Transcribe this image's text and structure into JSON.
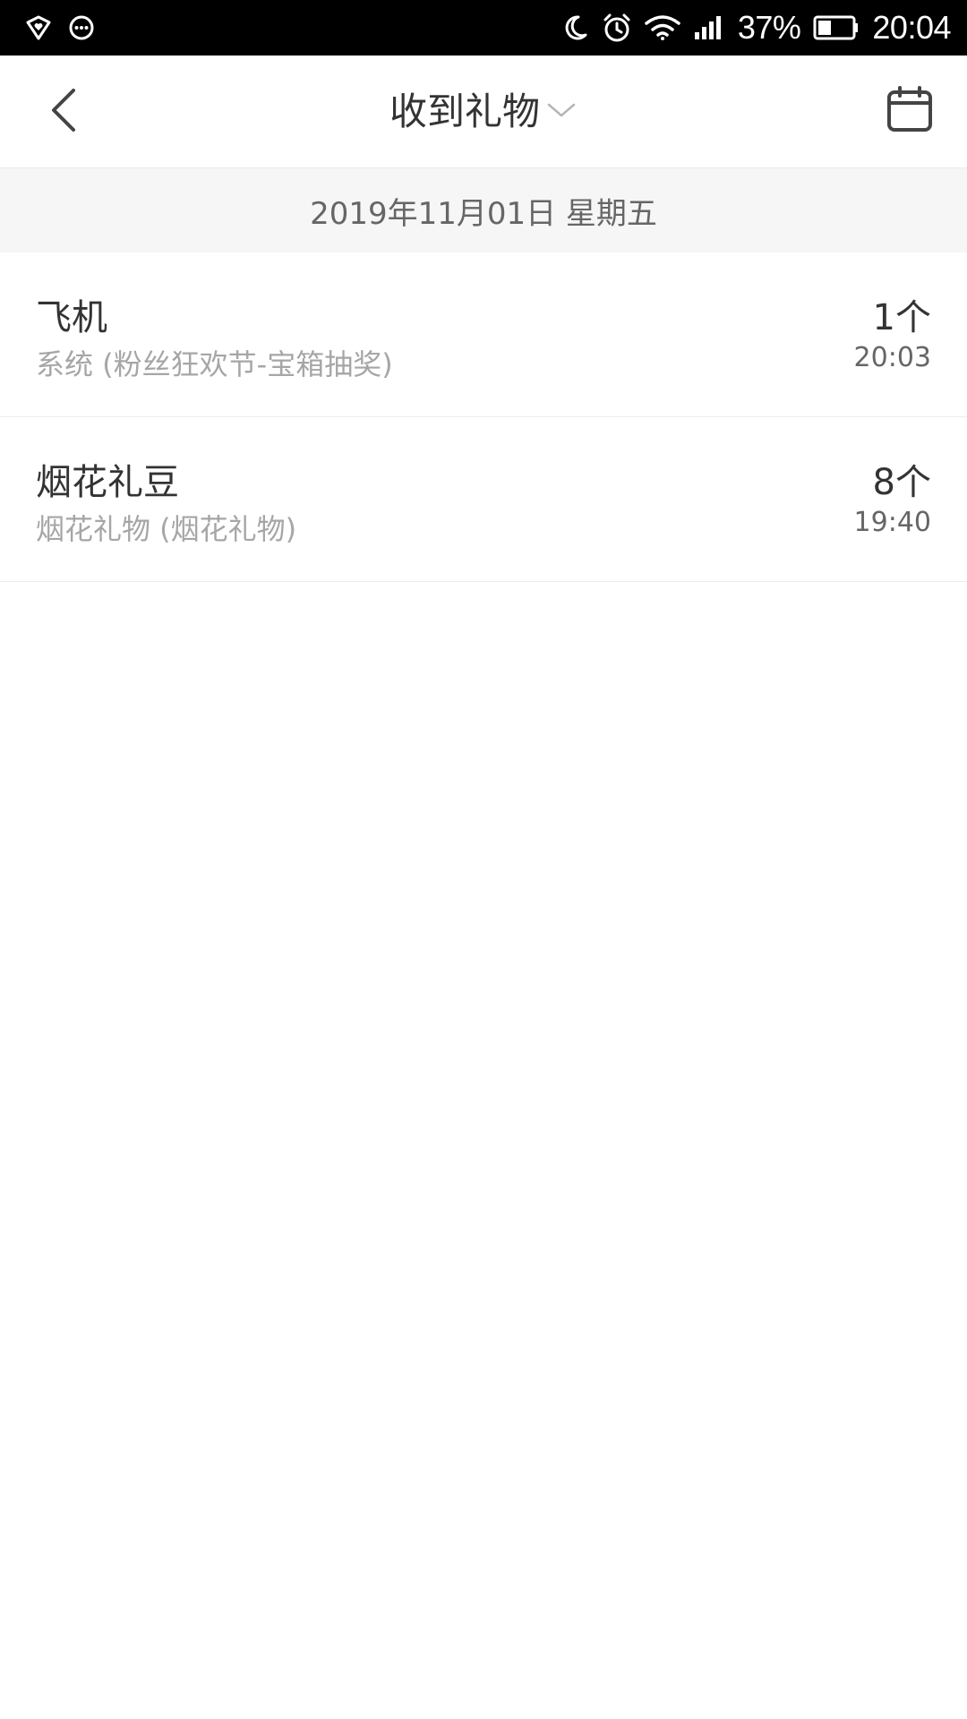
{
  "status_bar": {
    "battery_percent": "37%",
    "time": "20:04",
    "icons": [
      "shield-heart-icon",
      "chat-bubble-icon",
      "moon-icon",
      "alarm-icon",
      "wifi-icon",
      "signal-icon",
      "battery-icon"
    ]
  },
  "header": {
    "title": "收到礼物",
    "back_icon": "chevron-left-icon",
    "dropdown_icon": "chevron-down-icon",
    "calendar_icon": "calendar-icon"
  },
  "date_band": {
    "date": "2019年11月01日 星期五"
  },
  "gifts": [
    {
      "name": "飞机",
      "source": "系统 (粉丝狂欢节-宝箱抽奖)",
      "count": "1个",
      "time": "20:03"
    },
    {
      "name": "烟花礼豆",
      "source": "烟花礼物 (烟花礼物)",
      "count": "8个",
      "time": "19:40"
    }
  ],
  "colors": {
    "status_bar_bg": "#000000",
    "primary_text": "#333333",
    "secondary_text": "#a6a6a6",
    "date_band_bg": "#f6f6f6",
    "divider": "#ececec"
  }
}
